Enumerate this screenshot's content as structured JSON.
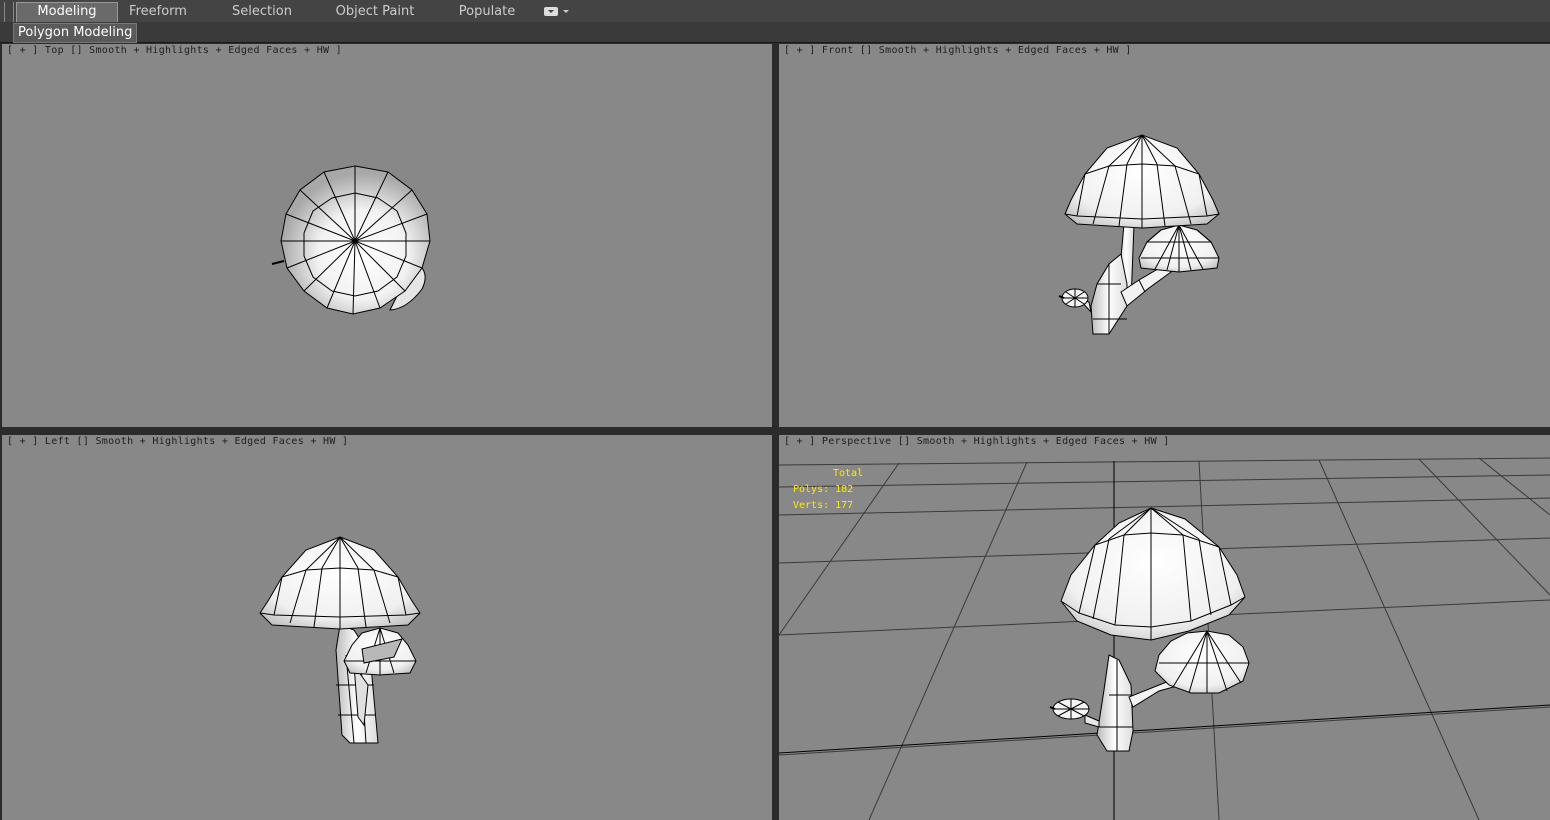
{
  "ribbon": {
    "tabs": [
      "Modeling",
      "Freeform",
      "Selection",
      "Object Paint",
      "Populate"
    ],
    "active_tab": "Modeling",
    "panel_label": "Polygon Modeling"
  },
  "viewports": {
    "top": "[ + ] Top [] Smooth + Highlights + Edged Faces + HW ]",
    "front": "[ + ] Front [] Smooth + Highlights + Edged Faces + HW ]",
    "left": "[ + ] Left [] Smooth + Highlights + Edged Faces + HW ]",
    "perspective": "[ + ] Perspective [] Smooth + Highlights + Edged Faces + HW ]"
  },
  "stats": {
    "title": "Total",
    "polys": "Polys: 182",
    "verts": "Verts: 177"
  },
  "colors": {
    "viewport_bg": "#888888",
    "stats_text": "#ffea00"
  }
}
